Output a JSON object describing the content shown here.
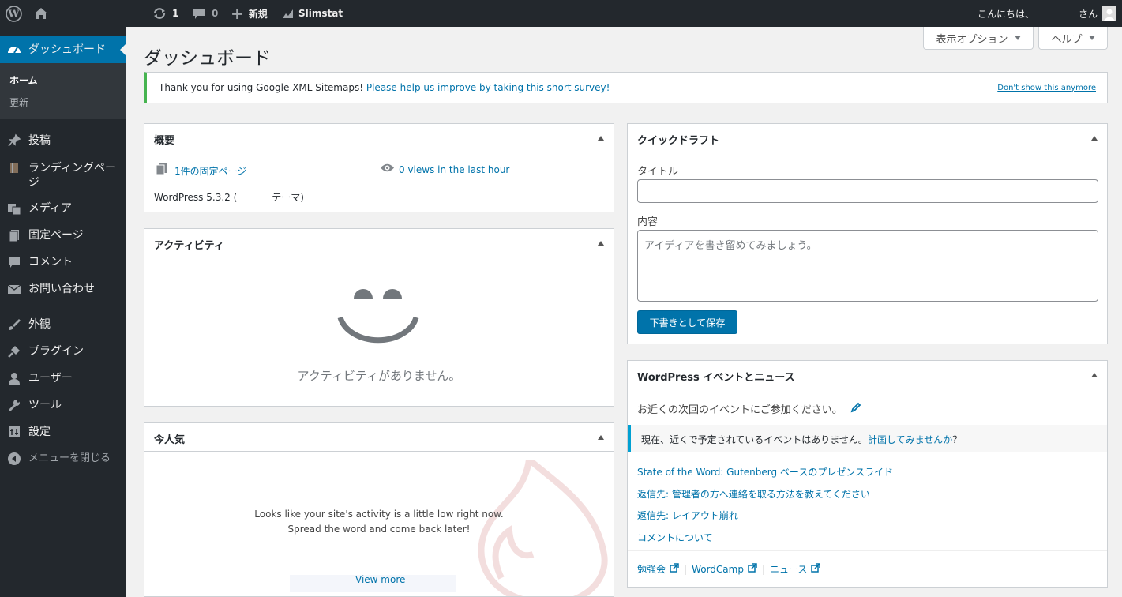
{
  "adminbar": {
    "updates_count": "1",
    "comments_count": "0",
    "new_label": "新規",
    "slimstat_label": "Slimstat",
    "greeting": "こんにちは、",
    "greeting_suffix": "さん"
  },
  "sidebar": {
    "dashboard": "ダッシュボード",
    "home": "ホーム",
    "updates": "更新",
    "items": [
      {
        "label": "投稿",
        "icon": "pin-icon"
      },
      {
        "label": "ランディングページ",
        "icon": "book-icon"
      },
      {
        "label": "メディア",
        "icon": "media-icon"
      },
      {
        "label": "固定ページ",
        "icon": "page-icon"
      },
      {
        "label": "コメント",
        "icon": "comment-icon"
      },
      {
        "label": "お問い合わせ",
        "icon": "mail-icon"
      },
      {
        "label": "外観",
        "icon": "brush-icon"
      },
      {
        "label": "プラグイン",
        "icon": "plugin-icon"
      },
      {
        "label": "ユーザー",
        "icon": "user-icon"
      },
      {
        "label": "ツール",
        "icon": "wrench-icon"
      },
      {
        "label": "設定",
        "icon": "settings-icon"
      }
    ],
    "collapse": "メニューを閉じる"
  },
  "header": {
    "title": "ダッシュボード",
    "screen_options": "表示オプション",
    "help": "ヘルプ"
  },
  "notice": {
    "text": "Thank you for using Google XML Sitemaps!",
    "link": "Please help us improve by taking this short survey!",
    "dismiss": "Don't show this anymore"
  },
  "overview": {
    "title": "概要",
    "pages": "1件の固定ページ",
    "views": "0 views in the last hour",
    "wp_version": "WordPress 5.3.2 (",
    "theme_suffix": "テーマ)"
  },
  "activity": {
    "title": "アクティビティ",
    "empty": "アクティビティがありません。"
  },
  "popular": {
    "title": "今人気",
    "line1": "Looks like your site's activity is a little low right now.",
    "line2": "Spread the word and come back later!",
    "view_more": "View more"
  },
  "quick_draft": {
    "title": "クイックドラフト",
    "title_label": "タイトル",
    "content_label": "内容",
    "content_placeholder": "アイディアを書き留めてみましょう。",
    "save": "下書きとして保存"
  },
  "events": {
    "title": "WordPress イベントとニュース",
    "intro": "お近くの次回のイベントにご参加ください。",
    "no_events": "現在、近くで予定されているイベントはありません。",
    "plan_link": "計画してみませんか",
    "plan_suffix": "？",
    "news": [
      "State of the Word: Gutenberg ベースのプレゼンスライド",
      "返信先: 管理者の方へ連絡を取る方法を教えてください",
      "返信先: レイアウト崩れ",
      "コメントについて"
    ],
    "footer": [
      "勉強会",
      "WordCamp",
      "ニュース"
    ]
  },
  "colors": {
    "adminbar": "#23282d",
    "accent": "#0073aa",
    "notice_border": "#46b450"
  }
}
